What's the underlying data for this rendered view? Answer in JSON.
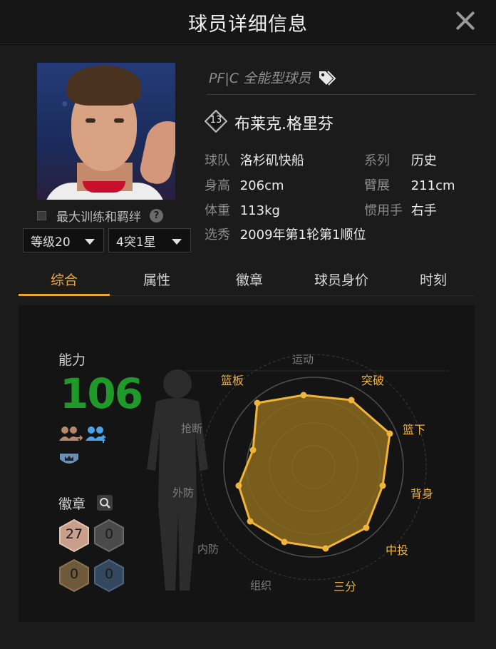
{
  "window": {
    "title": "球员详细信息"
  },
  "player": {
    "position": "PF|C 全能型球员",
    "number": "13",
    "name": "布莱克.格里芬",
    "bond_label": "最大训练和羁绊",
    "help_glyph": "?",
    "level_select": "等级20",
    "star_select": "4突1星"
  },
  "info": {
    "team_label": "球队",
    "team": "洛杉矶快船",
    "series_label": "系列",
    "series": "历史",
    "height_label": "身高",
    "height": "206cm",
    "wingspan_label": "臂展",
    "wingspan": "211cm",
    "weight_label": "体重",
    "weight": "113kg",
    "hand_label": "惯用手",
    "hand": "右手",
    "draft_label": "选秀",
    "draft": "2009年第1轮第1顺位"
  },
  "tabs": [
    {
      "label": "综合",
      "active": true
    },
    {
      "label": "属性",
      "active": false
    },
    {
      "label": "徽章",
      "active": false
    },
    {
      "label": "球员身价",
      "active": false
    },
    {
      "label": "时刻",
      "active": false
    }
  ],
  "stats": {
    "ability_label": "能力",
    "rating": "106",
    "rating_color": "#1f9a2a",
    "badges_label": "徽章",
    "badge_counts": [
      "27",
      "0",
      "0",
      "0"
    ]
  },
  "radar": {
    "labels": [
      "运动",
      "突破",
      "篮下",
      "背身",
      "中投",
      "三分",
      "组织",
      "内防",
      "外防",
      "抢断",
      "篮板"
    ],
    "highlighted": [
      "突破",
      "篮下",
      "背身",
      "中投",
      "三分",
      "篮板"
    ],
    "accent": "#f0b43a"
  }
}
